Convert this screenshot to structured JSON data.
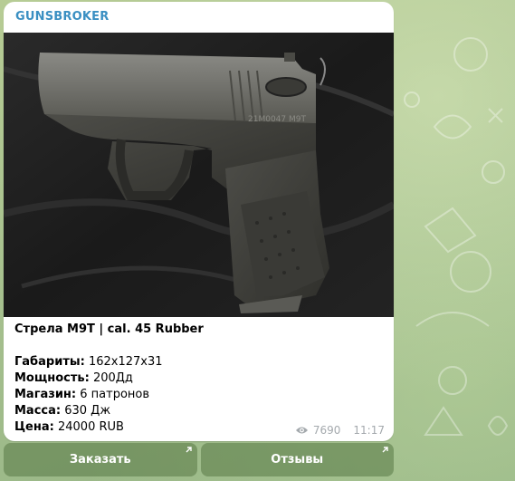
{
  "channel": {
    "name": "GUNSBROKER",
    "accent_color": "#3a8fc2"
  },
  "post": {
    "title": "Стрела М9Т | cal. 45 Rubber",
    "specs": [
      {
        "label": "Габариты:",
        "value": "162x127x31"
      },
      {
        "label": "Мощность:",
        "value": "200Дд"
      },
      {
        "label": "Магазин:",
        "value": "6 патронов"
      },
      {
        "label": "Масса:",
        "value": "630 Дж"
      },
      {
        "label": "Цена:",
        "value": "24000 RUB"
      }
    ],
    "views": "7690",
    "time": "11:17",
    "photo_text": "21M0047  M9T"
  },
  "buttons": [
    {
      "label": "Заказать",
      "icon": "external-link-arrow-icon"
    },
    {
      "label": "Отзывы",
      "icon": "external-link-arrow-icon"
    }
  ]
}
